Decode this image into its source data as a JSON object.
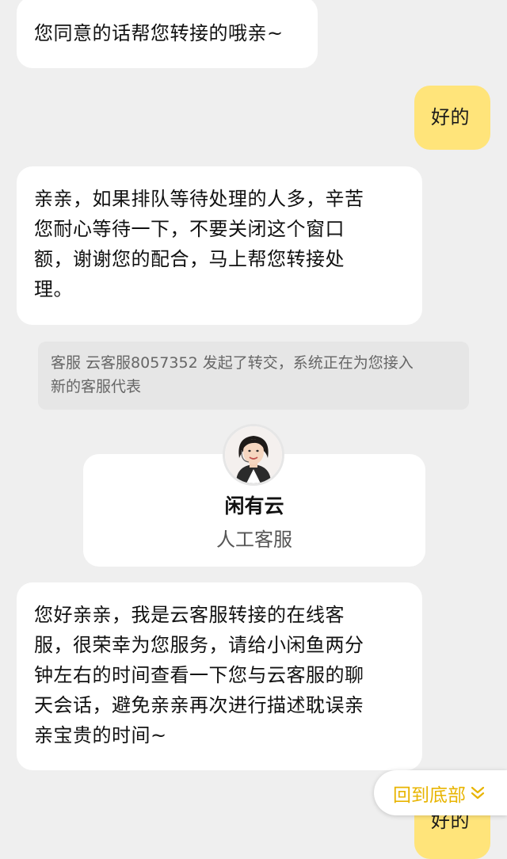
{
  "messages": [
    {
      "side": "left",
      "text": "您同意的话帮您转接的哦亲~"
    },
    {
      "side": "right",
      "text": "好的"
    },
    {
      "side": "left",
      "text": "亲亲，如果排队等待处理的人多，辛苦您耐心等待一下，不要关闭这个窗口额，谢谢您的配合，马上帮您转接处理。",
      "lines": [
        "亲亲，如果排队等待处理的人多，辛苦",
        "您耐心等待一下，不要关闭这个窗口",
        "额，谢谢您的配合，马上帮您转接处",
        "理。"
      ]
    },
    {
      "side": "left",
      "text": "您好亲亲，我是云客服转接的在线客服，很荣幸为您服务，请给小闲鱼两分钟左右的时间查看一下您与云客服的聊天会话，避免亲亲再次进行描述耽误亲亲宝贵的时间~",
      "lines": [
        "您好亲亲，我是云客服转接的在线客",
        "服，很荣幸为您服务，请给小闲鱼两分",
        "钟左右的时间查看一下您与云客服的聊",
        "天会话，避免亲亲再次进行描述耽误亲",
        "亲宝贵的时间~"
      ]
    },
    {
      "side": "right",
      "text": "好的"
    }
  ],
  "system_notice": {
    "text": "客服 云客服8057352 发起了转交，系统正在为您接入新的客服代表",
    "lines": [
      "客服 云客服8057352 发起了转交，系统正在为您接入",
      "新的客服代表"
    ]
  },
  "agent": {
    "name": "闲有云",
    "role": "人工客服",
    "avatar_icon": "agent-avatar-icon"
  },
  "back_to_bottom": {
    "label": "回到底部",
    "icon": "double-chevron-down-icon",
    "color": "#e8b400"
  },
  "colors": {
    "background": "#efefef",
    "left_bubble": "#ffffff",
    "right_bubble": "#ffe47a"
  }
}
